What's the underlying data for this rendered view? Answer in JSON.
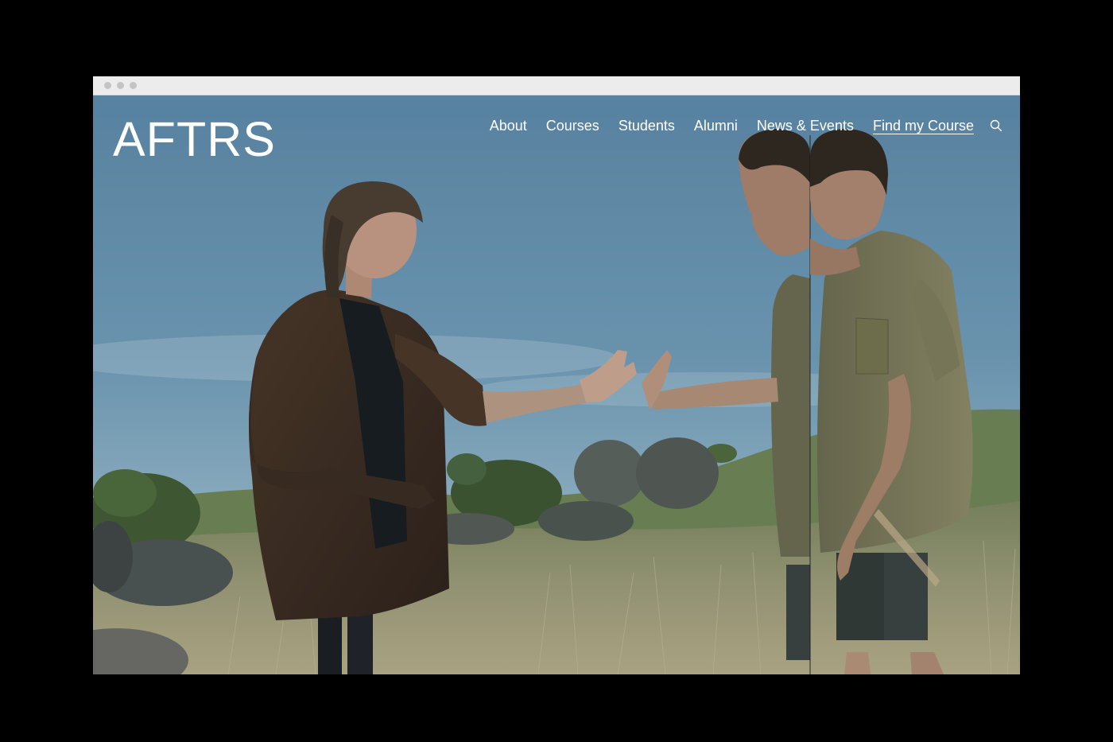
{
  "brand": {
    "logo_text": "AFTRS"
  },
  "nav": {
    "items": [
      {
        "label": "About"
      },
      {
        "label": "Courses"
      },
      {
        "label": "Students"
      },
      {
        "label": "Alumni"
      },
      {
        "label": "News & Events"
      },
      {
        "label": "Find my Course"
      }
    ],
    "search_icon": "search-icon"
  },
  "colors": {
    "page_background": "#000000",
    "chrome_bar": "#ececec",
    "nav_text": "#ffffff",
    "sky": "#5f8aa6"
  }
}
